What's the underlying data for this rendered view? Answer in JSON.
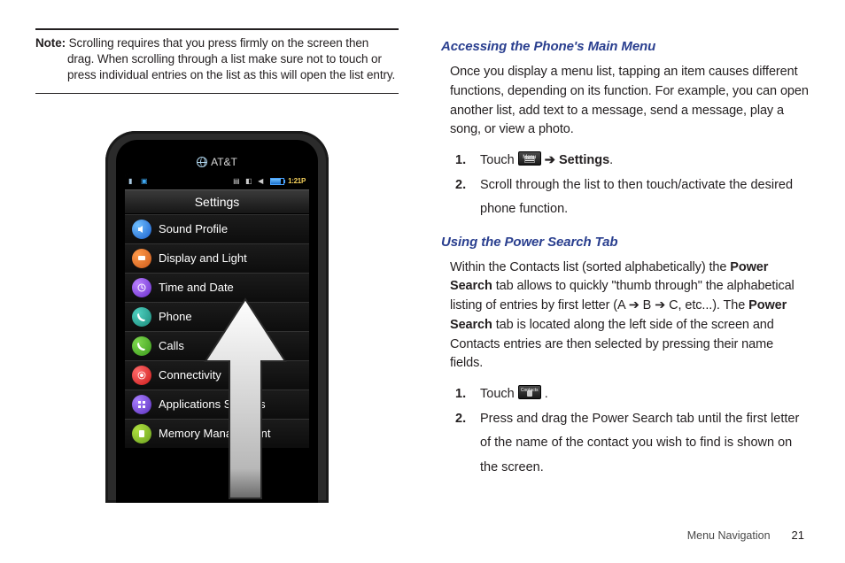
{
  "note": {
    "label": "Note:",
    "text": "Scrolling requires that you press firmly on the screen then drag. When scrolling through a list make sure not to touch or press individual entries on the list as this will open the list entry."
  },
  "phone": {
    "carrier": "AT&T",
    "clock": "1:21P",
    "title": "Settings",
    "items": [
      {
        "label": "Sound Profile",
        "icon": "ico-blue"
      },
      {
        "label": "Display and Light",
        "icon": "ico-orange"
      },
      {
        "label": "Time and Date",
        "icon": "ico-purple"
      },
      {
        "label": "Phone",
        "icon": "ico-teal"
      },
      {
        "label": "Calls",
        "icon": "ico-green"
      },
      {
        "label": "Connectivity",
        "icon": "ico-red"
      },
      {
        "label": "Applications Settings",
        "icon": "ico-purple2"
      },
      {
        "label": "Memory Management",
        "icon": "ico-lime"
      }
    ]
  },
  "section1": {
    "heading": "Accessing the Phone's Main Menu",
    "para": "Once you display a menu list, tapping an item causes different functions, depending on its function. For example, you can open another list, add text to a message, send a message, play a song, or view a photo.",
    "step1_a": "Touch ",
    "step1_b": " ➔ ",
    "step1_c": "Settings",
    "step1_d": ".",
    "step2": "Scroll through the list to then touch/activate the desired phone function."
  },
  "section2": {
    "heading": "Using the Power Search Tab",
    "para_a": "Within the Contacts list (sorted alphabetically) the ",
    "para_b": "Power Search",
    "para_c": " tab allows to quickly \"thumb through\" the alphabetical listing of entries by first letter (A ➔ B ➔ C, etc...). The ",
    "para_d": "Power Search",
    "para_e": " tab is located along the left side of the screen and Contacts entries are then selected by pressing their name fields.",
    "step1_a": "Touch ",
    "step1_b": " .",
    "step2": "Press and drag the Power Search tab until the first letter of the name of the contact you wish to find is shown on the screen."
  },
  "footer": {
    "section": "Menu Navigation",
    "page": "21"
  }
}
